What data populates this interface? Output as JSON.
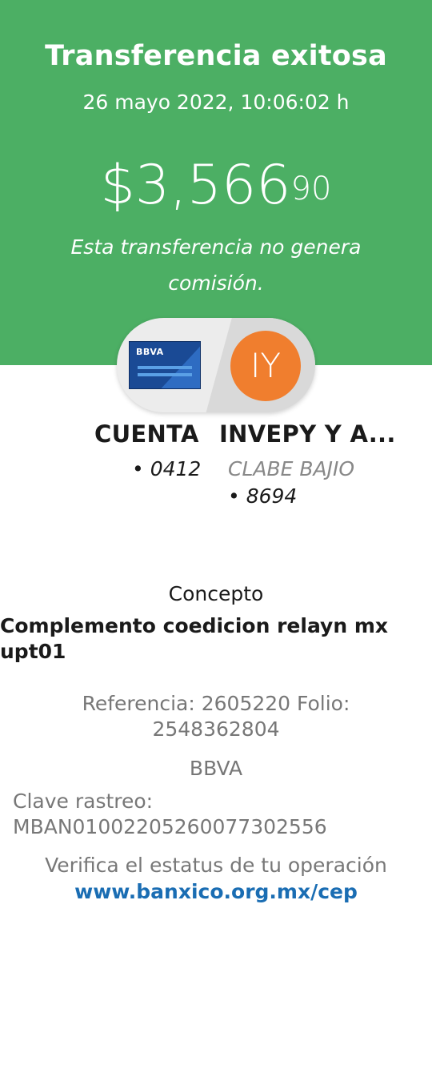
{
  "header": {
    "title": "Transferencia exitosa",
    "datetime": "26 mayo 2022, 10:06:02 h",
    "amount_main": "$3,566",
    "amount_cents": "90",
    "commission_note": "Esta transferencia no genera comisión."
  },
  "colors": {
    "hero_green": "#4caf64",
    "avatar_orange": "#f07e2e",
    "bbva_blue": "#1a4a95",
    "link_blue": "#1a6db3"
  },
  "origin": {
    "card_logo": "BBVA",
    "icon": "bbva-card-icon",
    "label": "CUENTA",
    "number": "• 0412"
  },
  "destination": {
    "initials": "IY",
    "label": "INVEPY Y A...",
    "bank": "CLABE BAJIO",
    "number": "• 8694"
  },
  "details": {
    "concept_label": "Concepto",
    "concept_value": "Complemento coedicion relayn mx upt01",
    "reference": "Referencia: 2605220   Folio: 2548362804",
    "bank": "BBVA",
    "tracking": "Clave rastreo: MBAN01002205260077302556",
    "verify_text": "Verifica el estatus de tu operación",
    "verify_link": "www.banxico.org.mx/cep"
  }
}
